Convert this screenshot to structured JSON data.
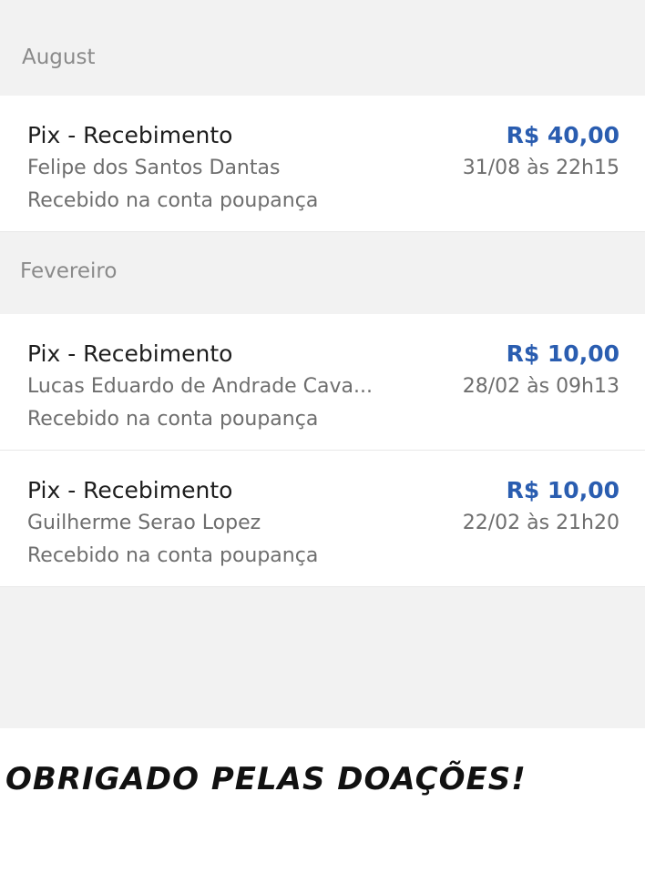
{
  "sections": [
    {
      "month": "August",
      "items": [
        {
          "title": "Pix - Recebimento",
          "amount": "R$ 40,00",
          "name": "Felipe dos Santos Dantas",
          "datetime": "31/08 às 22h15",
          "subtitle": "Recebido na conta poupança"
        }
      ]
    },
    {
      "month": "Fevereiro",
      "items": [
        {
          "title": "Pix - Recebimento",
          "amount": "R$ 10,00",
          "name": "Lucas Eduardo de Andrade Cava...",
          "datetime": "28/02 às 09h13",
          "subtitle": "Recebido na conta poupança"
        },
        {
          "title": "Pix - Recebimento",
          "amount": "R$ 10,00",
          "name": "Guilherme Serao Lopez",
          "datetime": "22/02 às 21h20",
          "subtitle": "Recebido na conta poupança"
        }
      ]
    }
  ],
  "caption": "Obrigado pelas doações!",
  "colors": {
    "amount": "#2a5db0",
    "background": "#f2f2f2",
    "card": "#ffffff",
    "muted_text": "#6e6e6e"
  }
}
